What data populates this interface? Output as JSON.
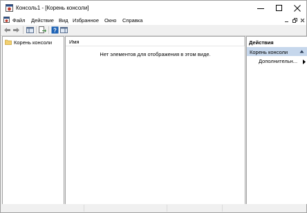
{
  "window": {
    "title": "Консоль1 - [Корень консоли]"
  },
  "menubar": {
    "items": [
      "Файл",
      "Действие",
      "Вид",
      "Избранное",
      "Окно",
      "Справка"
    ]
  },
  "tree": {
    "root_label": "Корень консоли"
  },
  "list": {
    "column_name": "Имя",
    "empty_message": "Нет элементов для отображения в этом виде."
  },
  "actions": {
    "title": "Действия",
    "group_label": "Корень консоли",
    "more_label": "Дополнительн..."
  },
  "colors": {
    "accent_selection": "#c6d7ec",
    "app_icon_red": "#c0392b",
    "help_icon_blue": "#1e63b5"
  }
}
